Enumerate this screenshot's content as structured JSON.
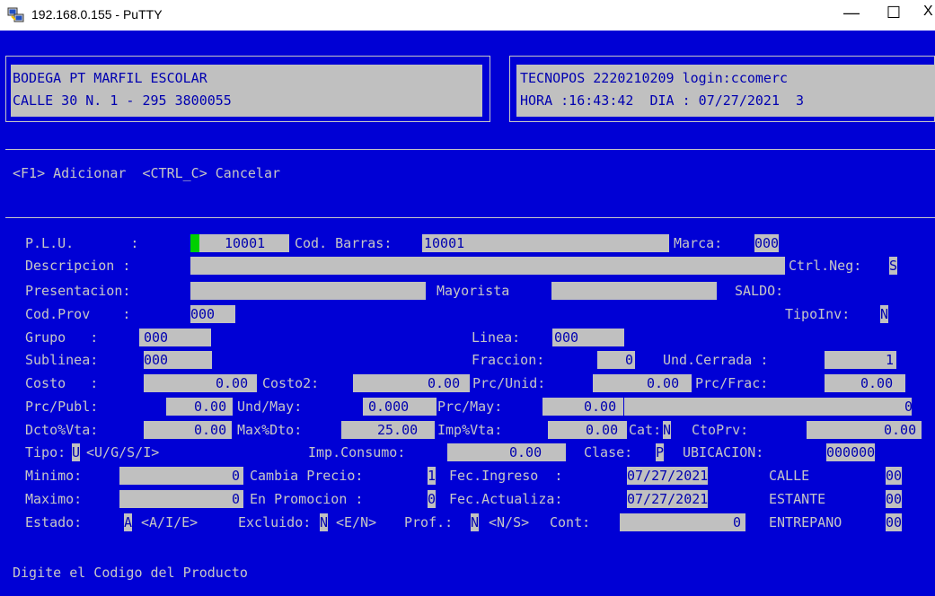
{
  "window": {
    "title": "192.168.0.155 - PuTTY",
    "icon": "putty-icon",
    "controls": {
      "minimize": "—",
      "maximize": "☐",
      "close": "X"
    }
  },
  "header": {
    "company_line1": "BODEGA PT MARFIL ESCOLAR",
    "company_line2": "CALLE 30 N. 1 - 295 3800055",
    "system_line1": "TECNOPOS 2220210209 login:ccomerc",
    "system_line2": "HORA :16:43:42  DIA : 07/27/2021  3"
  },
  "keys": {
    "text": "<F1> Adicionar  <CTRL_C> Cancelar"
  },
  "form": {
    "plu_label": "P.L.U.       :",
    "plu_value": "10001",
    "barcode_label": "Cod. Barras:",
    "barcode_value": "10001",
    "marca_label": "Marca:",
    "marca_value": "000",
    "descripcion_label": "Descripcion :",
    "ctrlneg_label": "Ctrl.Neg:",
    "ctrlneg_value": "S",
    "presentacion_label": "Presentacion:",
    "presentacion_value": "Mayorista",
    "saldo_label": "SALDO:",
    "codprov_label": "Cod.Prov    :",
    "codprov_value": "000",
    "tipoinv_label": "TipoInv:",
    "tipoinv_value": "N",
    "grupo_label": "Grupo   :",
    "grupo_value": "000",
    "linea_label": "Linea:",
    "linea_value": "000",
    "sublinea_label": "Sublinea:",
    "sublinea_value": "000",
    "fraccion_label": "Fraccion:",
    "fraccion_value": "0",
    "undcerrada_label": "Und.Cerrada :",
    "undcerrada_value": "1",
    "costo_label": "Costo   :",
    "costo_value": "0.00",
    "costo2_label": "Costo2:",
    "costo2_value": "0.00",
    "prcunid_label": "Prc/Unid:",
    "prcunid_value": "0.00",
    "prcfrac_label": "Prc/Frac:",
    "prcfrac_value": "0.00",
    "prcpubl_label": "Prc/Publ:",
    "prcpubl_value": "0.00",
    "undmay_label": "Und/May:",
    "undmay_value": "0.000",
    "prcmay_label": "Prc/May:",
    "prcmay_value": "0.00",
    "extra_value": "0",
    "dctovta_label": "Dcto%Vta:",
    "dctovta_value": "0.00",
    "maxdto_label": "Max%Dto:",
    "maxdto_value": "25.00",
    "impvta_label": "Imp%Vta:",
    "impvta_value": "0.00",
    "cat_label": "Cat:",
    "cat_value": "N",
    "ctoprv_label": "CtoPrv:",
    "ctoprv_value": "0.00",
    "tipo_label": "Tipo:",
    "tipo_value": "U",
    "tipo_options": "<U/G/S/I>",
    "impconsumo_label": "Imp.Consumo:",
    "impconsumo_value": "0.00",
    "clase_label": "Clase:",
    "clase_value": "P",
    "ubicacion_label": "UBICACION:",
    "ubicacion_value": "000000",
    "minimo_label": "Minimo:",
    "minimo_value": "0",
    "cambiaprecio_label": "Cambia Precio:",
    "cambiaprecio_value": "1",
    "fecingreso_label": "Fec.Ingreso  :",
    "fecingreso_value": "07/27/2021",
    "calle_label": "CALLE",
    "calle_value": "00",
    "maximo_label": "Maximo:",
    "maximo_value": "0",
    "enpromocion_label": "En Promocion :",
    "enpromocion_value": "0",
    "fecactualiza_label": "Fec.Actualiza:",
    "fecactualiza_value": "07/27/2021",
    "estante_label": "ESTANTE",
    "estante_value": "00",
    "estado_label": "Estado:",
    "estado_value": "A",
    "estado_options": "<A/I/E>",
    "excluido_label": "Excluido:",
    "excluido_value": "N",
    "excluido_options": "<E/N>",
    "prof_label": "Prof.:",
    "prof_value": "N",
    "prof_options": "<N/S>",
    "cont_label": "Cont:",
    "cont_value": "0",
    "entrepano_label": "ENTREPANO",
    "entrepano_value": "00"
  },
  "status": {
    "message": "Digite el Codigo del Producto"
  },
  "colors": {
    "terminal_bg": "#0000d5",
    "terminal_fg": "#c6c6c6",
    "field_bg": "#c0c0c0",
    "cursor": "#00d000"
  }
}
